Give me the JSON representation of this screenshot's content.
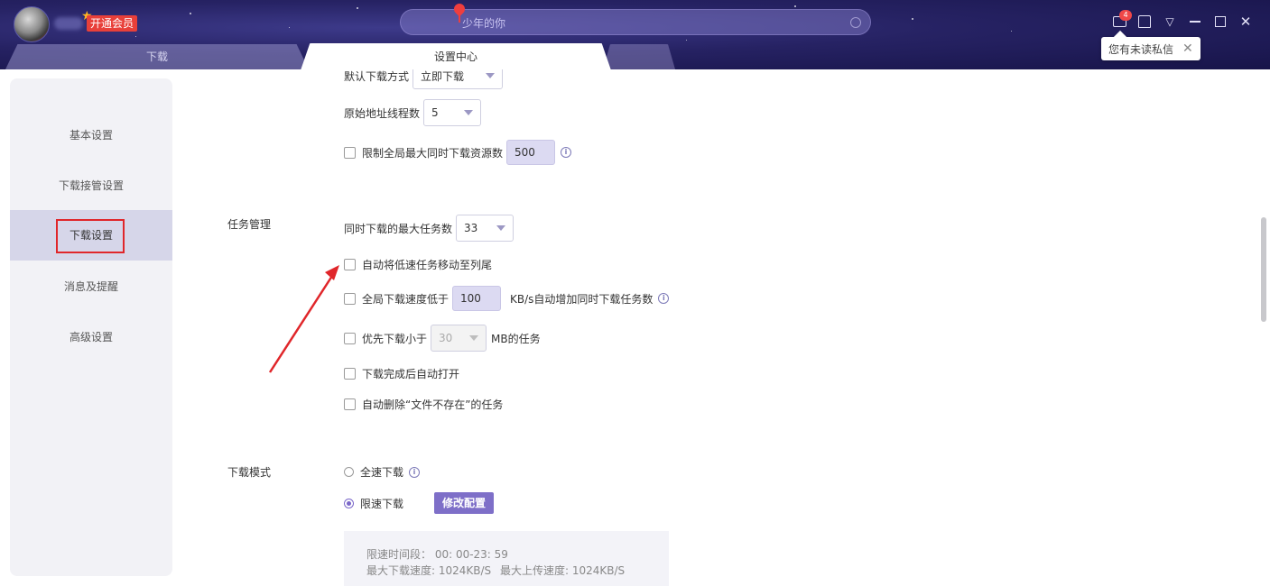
{
  "titlebar": {
    "vip_badge": "开通会员",
    "search_placeholder": "少年的你",
    "message_count": "4",
    "tooltip_text": "您有未读私信",
    "tooltip_close": "✕"
  },
  "tabs": {
    "download": "下载",
    "settings_center": "设置中心",
    "third": ""
  },
  "sidebar": {
    "items": [
      {
        "label": "基本设置"
      },
      {
        "label": "下载接管设置"
      },
      {
        "label": "下载设置",
        "active": true
      },
      {
        "label": "消息及提醒"
      },
      {
        "label": "高级设置"
      }
    ]
  },
  "download_settings": {
    "default_method_label": "默认下载方式",
    "default_method_value": "立即下载",
    "origin_threads_label": "原始地址线程数",
    "origin_threads_value": "5",
    "limit_global_label": "限制全局最大同时下载资源数",
    "limit_global_value": "500"
  },
  "task_management": {
    "section_label": "任务管理",
    "max_tasks_label": "同时下载的最大任务数",
    "max_tasks_value": "33",
    "auto_move_label": "自动将低速任务移动至列尾",
    "speed_below_label": "全局下载速度低于",
    "speed_below_value": "100",
    "speed_below_suffix": "KB/s自动增加同时下载任务数",
    "prefer_small_label": "优先下载小于",
    "prefer_small_value": "30",
    "prefer_small_suffix": "MB的任务",
    "auto_open_label": "下载完成后自动打开",
    "auto_delete_label": "自动删除“文件不存在”的任务"
  },
  "download_mode": {
    "section_label": "下载模式",
    "full_speed_label": "全速下载",
    "limited_speed_label": "限速下载",
    "modify_config_button": "修改配置",
    "limit_period": "限速时间段： 00: 00-23: 59",
    "max_download_speed": "最大下载速度: 1024KB/S",
    "max_upload_speed": "最大上传速度: 1024KB/S"
  },
  "colors": {
    "accent": "#7e6fc8",
    "highlight_red": "#e0262a",
    "titlebar_bg": "#262263"
  }
}
